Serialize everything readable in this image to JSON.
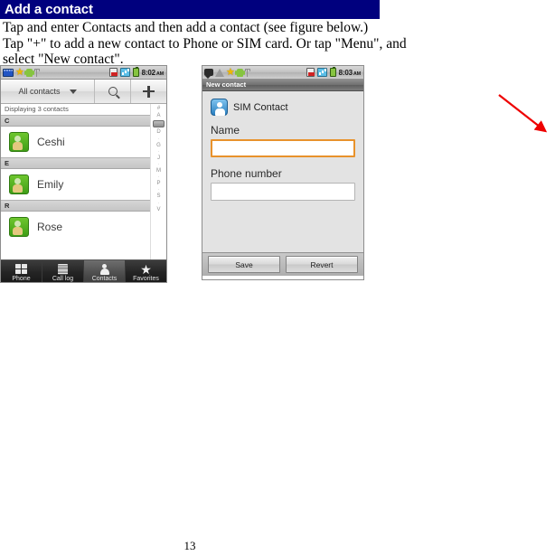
{
  "document": {
    "header_title": "Add a contact",
    "paragraphs": [
      "Tap and enter Contacts and then add a contact (see figure below.)",
      "Tap \"+\" to add a new  contact to Phone or SIM card. Or tap \"Menu\", and",
      "select \"New contact\"."
    ],
    "page_number": "13",
    "header_bg": "#00007e",
    "arrow_color": "#ee0000"
  },
  "phone_left": {
    "statusbar": {
      "time": "8:02",
      "ampm": "AM",
      "left_icons": [
        "message-badge-icon",
        "star-icon",
        "android-icon",
        "usb-icon"
      ],
      "right_icons": [
        "sd-card-icon",
        "signal-bars-icon",
        "battery-icon"
      ]
    },
    "actionbar": {
      "spinner_label": "All contacts",
      "spinner_icon": "chevron-down-icon",
      "search_icon": "search-icon",
      "add_icon": "plus-icon"
    },
    "list": {
      "status_text": "Displaying 3 contacts",
      "rows": [
        {
          "type": "section",
          "label": "C"
        },
        {
          "type": "contact",
          "name": "Ceshi"
        },
        {
          "type": "section",
          "label": "E"
        },
        {
          "type": "contact",
          "name": "Emily"
        },
        {
          "type": "section",
          "label": "R"
        },
        {
          "type": "contact",
          "name": "Rose"
        }
      ],
      "index_strip": [
        "#",
        "A",
        "",
        "D",
        "·",
        "G",
        "·",
        "J",
        "·",
        "M",
        "·",
        "P",
        "·",
        "S",
        "·",
        "V"
      ]
    },
    "tabbar": {
      "tabs": [
        {
          "label": "Phone",
          "icon": "keypad-icon",
          "active": false
        },
        {
          "label": "Call log",
          "icon": "call-log-icon",
          "active": false
        },
        {
          "label": "Contacts",
          "icon": "person-icon",
          "active": true
        },
        {
          "label": "Favorites",
          "icon": "star-icon",
          "active": false
        }
      ]
    }
  },
  "phone_right": {
    "statusbar": {
      "time": "8:03",
      "ampm": "AM",
      "left_icons": [
        "message-icon",
        "warning-icon",
        "star-icon",
        "android-icon",
        "usb-icon"
      ],
      "right_icons": [
        "sd-card-icon",
        "signal-bars-icon",
        "battery-icon"
      ]
    },
    "title": "New contact",
    "form": {
      "account_label": "SIM Contact",
      "account_icon": "sim-contact-avatar-icon",
      "name_label": "Name",
      "name_value": "",
      "name_focused": true,
      "phone_label": "Phone number",
      "phone_value": ""
    },
    "buttons": {
      "save_label": "Save",
      "revert_label": "Revert"
    }
  }
}
